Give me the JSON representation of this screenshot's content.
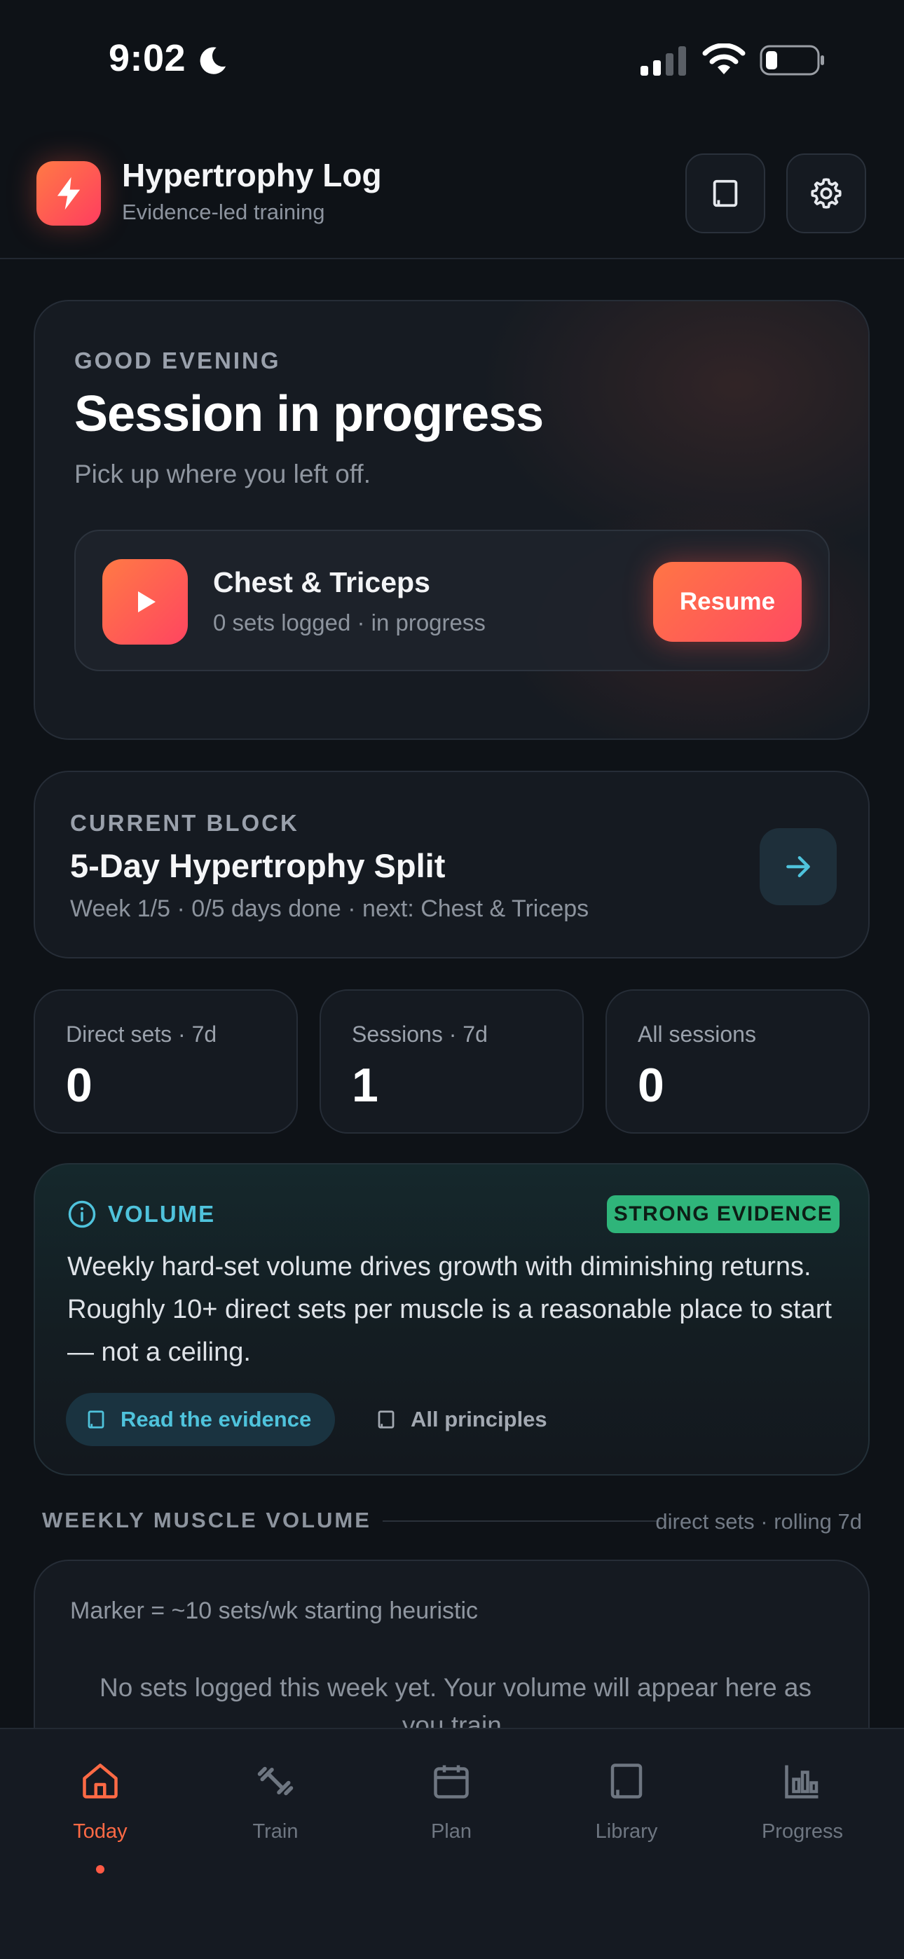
{
  "status_bar": {
    "time": "9:02"
  },
  "header": {
    "title": "Hypertrophy Log",
    "subtitle": "Evidence-led training"
  },
  "hero": {
    "greeting": "GOOD EVENING",
    "title": "Session in progress",
    "subtitle": "Pick up where you left off.",
    "session": {
      "name": "Chest & Triceps",
      "meta": "0 sets logged · in progress",
      "resume_label": "Resume"
    }
  },
  "current_block": {
    "eyebrow": "CURRENT BLOCK",
    "title": "5-Day Hypertrophy Split",
    "meta": "Week 1/5 · 0/5 days done · next: Chest & Triceps"
  },
  "stats": [
    {
      "label": "Direct sets · 7d",
      "value": "0"
    },
    {
      "label": "Sessions · 7d",
      "value": "1"
    },
    {
      "label": "All sessions",
      "value": "0"
    }
  ],
  "volume_card": {
    "label": "VOLUME",
    "badge": "STRONG EVIDENCE",
    "body": "Weekly hard-set volume drives growth with diminishing returns. Roughly 10+ direct sets per muscle is a reasonable place to start — not a ceiling.",
    "read_label": "Read the evidence",
    "all_label": "All principles"
  },
  "weekly_section": {
    "title": "WEEKLY MUSCLE VOLUME",
    "note": "direct sets · rolling 7d",
    "marker": "Marker = ~10 sets/wk starting heuristic",
    "empty": "No sets logged this week yet. Your volume will appear here as you train."
  },
  "nav": [
    {
      "label": "Today",
      "icon": "home-icon",
      "active": true
    },
    {
      "label": "Train",
      "icon": "dumbbell-icon"
    },
    {
      "label": "Plan",
      "icon": "calendar-icon"
    },
    {
      "label": "Library",
      "icon": "book-icon"
    },
    {
      "label": "Progress",
      "icon": "bar-chart-icon"
    }
  ],
  "colors": {
    "accent": "#ff5a45",
    "info": "#4fc3dc",
    "evidence_badge": "#2fb57a",
    "background": "#0e1217"
  }
}
